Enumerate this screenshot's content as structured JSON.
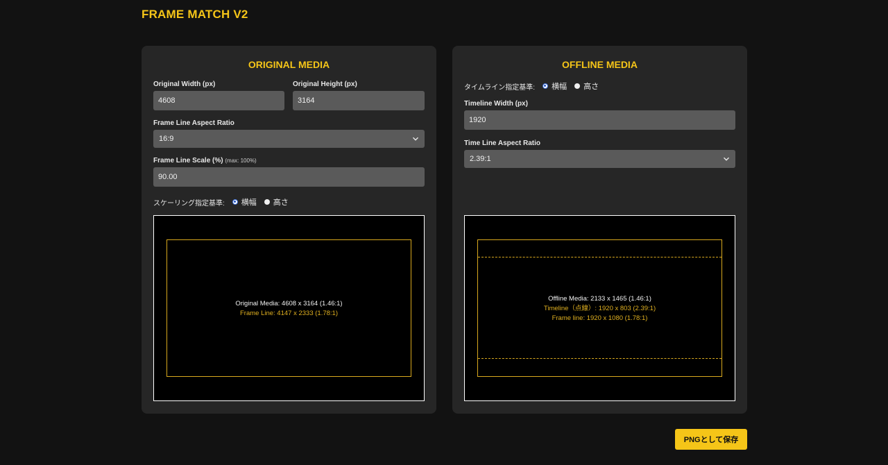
{
  "app": {
    "title": "FRAME MATCH V2"
  },
  "original": {
    "title": "ORIGINAL MEDIA",
    "width_label": "Original Width (px)",
    "width_value": "4608",
    "height_label": "Original Height (px)",
    "height_value": "3164",
    "aspect_label": "Frame Line Aspect Ratio",
    "aspect_value": "16:9",
    "scale_label": "Frame Line Scale (%)",
    "scale_hint": "(max: 100%)",
    "scale_value": "90.00",
    "scaling_basis_label": "スケーリング指定基準:",
    "option_width": "横幅",
    "option_height": "高さ",
    "preview_media": "Original Media: 4608 x 3164 (1.46:1)",
    "preview_frame": "Frame Line: 4147 x 2333 (1.78:1)"
  },
  "offline": {
    "title": "OFFLINE MEDIA",
    "timeline_basis_label": "タイムライン指定基準:",
    "option_width": "横幅",
    "option_height": "高さ",
    "timeline_width_label": "Timeline Width (px)",
    "timeline_width_value": "1920",
    "aspect_label": "Time Line Aspect Ratio",
    "aspect_value": "2.39:1",
    "preview_media": "Offline Media: 2133 x 1465 (1.46:1)",
    "preview_timeline": "Timeline（点線）: 1920 x 803 (2.39:1)",
    "preview_frame": "Frame line: 1920 x 1080 (1.78:1)"
  },
  "actions": {
    "save_png": "PNGとして保存"
  },
  "colors": {
    "accent": "#f5c518",
    "frame_line": "#d9a91e",
    "panel": "#262626",
    "background": "#121212"
  }
}
